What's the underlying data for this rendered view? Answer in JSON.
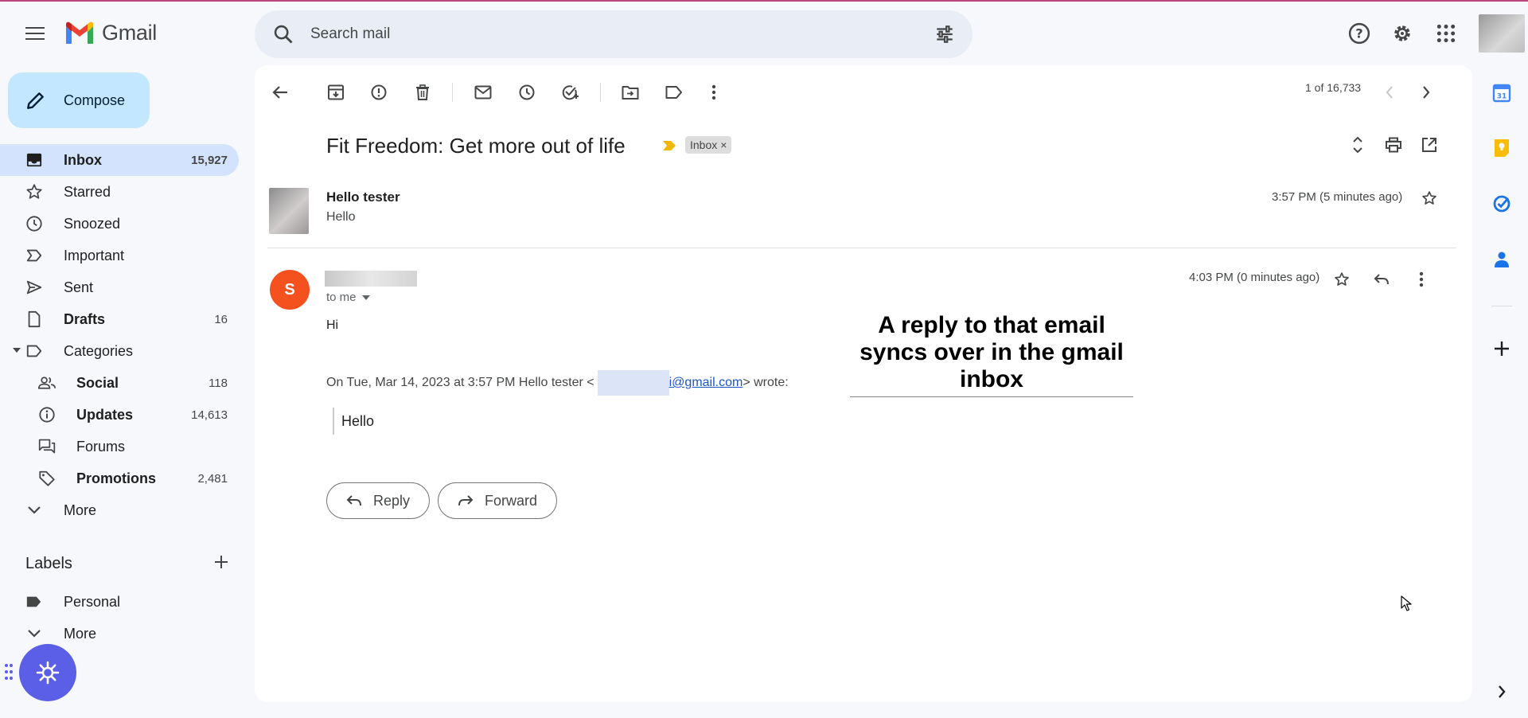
{
  "header": {
    "app_name": "Gmail",
    "search_placeholder": "Search mail"
  },
  "compose": {
    "label": "Compose"
  },
  "nav": {
    "inbox": {
      "label": "Inbox",
      "count": "15,927"
    },
    "starred": {
      "label": "Starred"
    },
    "snoozed": {
      "label": "Snoozed"
    },
    "important": {
      "label": "Important"
    },
    "sent": {
      "label": "Sent"
    },
    "drafts": {
      "label": "Drafts",
      "count": "16"
    },
    "categories": {
      "label": "Categories"
    },
    "social": {
      "label": "Social",
      "count": "118"
    },
    "updates": {
      "label": "Updates",
      "count": "14,613"
    },
    "forums": {
      "label": "Forums"
    },
    "promotions": {
      "label": "Promotions",
      "count": "2,481"
    },
    "more": {
      "label": "More"
    }
  },
  "labels": {
    "heading": "Labels",
    "personal": "Personal",
    "more": "More"
  },
  "toolbar": {
    "pager": "1 of 16,733"
  },
  "thread": {
    "subject": "Fit Freedom: Get more out of life",
    "label_chip": "Inbox",
    "label_chip_close": "×"
  },
  "message1": {
    "sender": "Hello tester",
    "snippet": "Hello",
    "time": "3:57 PM (5 minutes ago)"
  },
  "message2": {
    "avatar_letter": "S",
    "to": "to me",
    "time": "4:03 PM (0 minutes ago)",
    "body": "Hi",
    "quote_prefix": "On Tue, Mar 14, 2023 at 3:57 PM Hello tester <",
    "quote_email": "i@gmail.com",
    "quote_suffix": "> wrote:",
    "quoted_text": "Hello"
  },
  "actions": {
    "reply": "Reply",
    "forward": "Forward"
  },
  "annotation": "A reply to that email syncs over in the gmail inbox",
  "colors": {
    "compose_bg": "#c2e7ff",
    "active_nav": "#d3e3fd",
    "avatar_orange": "#f4511e",
    "fab": "#5b5ee6"
  }
}
